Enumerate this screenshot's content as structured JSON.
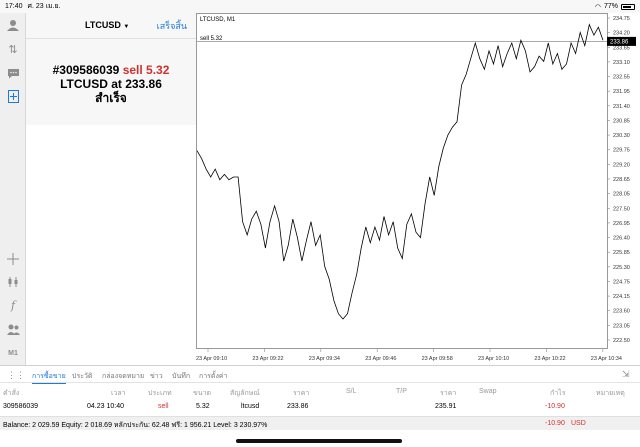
{
  "status_bar": {
    "time": "17:40",
    "date": "ศ. 23 เม.ย.",
    "battery": "77%"
  },
  "order_panel": {
    "symbol": "LTCUSD",
    "done_label": "เสร็จสิ้น",
    "ticket_line_prefix": "#309586039",
    "ticket_sell": "sell 5.32",
    "price_line": "LTCUSD at 233.86",
    "result": "สำเร็จ"
  },
  "chart": {
    "symbol_label": "LTCUSD, M1",
    "trade_line_label": "sell 5.32",
    "current_price_label": "233.86"
  },
  "chart_data": {
    "type": "line",
    "y_ticks": [
      "234.75",
      "234.20",
      "233.65",
      "233.10",
      "232.55",
      "231.95",
      "231.40",
      "230.85",
      "230.30",
      "229.75",
      "229.20",
      "228.65",
      "228.05",
      "227.50",
      "226.95",
      "226.40",
      "225.85",
      "225.30",
      "224.75",
      "224.15",
      "223.60",
      "223.05",
      "222.50"
    ],
    "x_ticks": [
      "23 Apr 09:10",
      "23 Apr 09:22",
      "23 Apr 09:34",
      "23 Apr 09:46",
      "23 Apr 09:58",
      "23 Apr 10:10",
      "23 Apr 10:22",
      "23 Apr 10:34"
    ],
    "ylim": [
      222.5,
      234.75
    ],
    "trade_level": 233.86,
    "values": [
      229.7,
      229.4,
      229.0,
      228.7,
      229.0,
      228.6,
      228.8,
      228.6,
      228.7,
      228.7,
      227.0,
      226.5,
      227.1,
      227.4,
      226.9,
      226.0,
      227.0,
      227.6,
      227.0,
      225.5,
      226.1,
      227.1,
      226.4,
      225.5,
      226.3,
      227.0,
      226.1,
      226.5,
      225.3,
      224.8,
      224.0,
      223.5,
      223.3,
      223.5,
      224.3,
      225.0,
      226.0,
      226.8,
      226.2,
      226.8,
      226.3,
      227.2,
      226.5,
      227.0,
      226.0,
      225.6,
      226.9,
      227.3,
      226.6,
      226.4,
      227.7,
      228.7,
      228.0,
      229.1,
      229.8,
      230.3,
      230.6,
      230.8,
      232.2,
      232.6,
      233.2,
      233.8,
      233.2,
      232.8,
      233.5,
      233.0,
      233.7,
      232.9,
      233.4,
      233.8,
      233.2,
      233.9,
      233.5,
      232.7,
      232.9,
      233.3,
      233.1,
      233.8,
      233.0,
      233.4,
      232.8,
      233.0,
      233.8,
      233.4,
      234.2,
      233.7,
      234.5,
      234.1,
      234.4,
      233.9
    ]
  },
  "tabs": [
    "การซื้อขาย",
    "ประวัติ",
    "กล่องจดหมาย",
    "ข่าว",
    "บันทึก",
    "การตั้งค่า"
  ],
  "table": {
    "headers": [
      "คำสั่ง",
      "เวลา",
      "ประเภท",
      "ขนาด",
      "สัญลักษณ์",
      "ราคา",
      "S/L",
      "T/P",
      "ราคา",
      "Swap",
      "กำไร",
      "หมายเหตุ"
    ],
    "row": {
      "order": "309586039",
      "time": "04.23 10:40",
      "type": "sell",
      "size": "5.32",
      "symbol": "ltcusd",
      "price": "233.86",
      "current_price": "235.91",
      "profit": "-10.90"
    }
  },
  "balance": {
    "text": "Balance: 2 029.59 Equity: 2 018.69 หลักประกัน: 62.48 ฟรี: 1 956.21 Level: 3 230.97%",
    "total": "-10.90",
    "currency": "USD"
  },
  "colors": {
    "accent": "#1e7ad6",
    "sell": "#d0312d"
  }
}
